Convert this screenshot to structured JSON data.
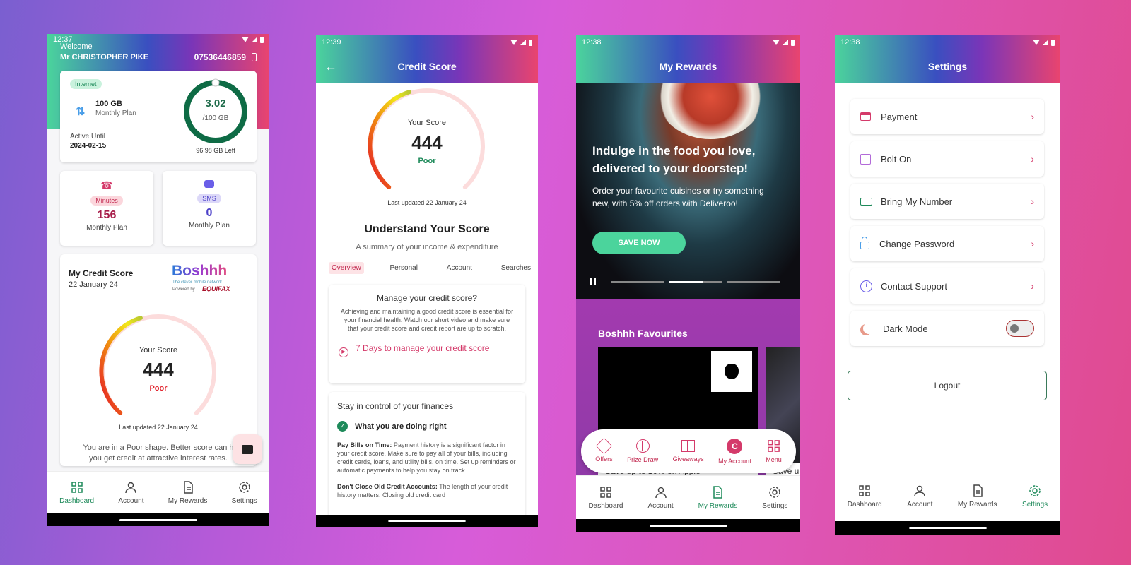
{
  "colors": {
    "brand_green": "#1e8a5a",
    "accent_pink": "#d43a6a",
    "poor_red": "#e0202a",
    "sms_blue": "#4b3fc8"
  },
  "phone1": {
    "time": "12:37",
    "welcome": "Welcome",
    "user_name": "Mr CHRISTOPHER PIKE",
    "phone_number": "07536446859",
    "internet_badge": "Internet",
    "data_amount": "100 GB",
    "data_plan": "Monthly Plan",
    "active_until_label": "Active Until",
    "active_until_date": "2024-02-15",
    "data_used": "3.02",
    "data_total": "/100 GB",
    "data_left": "96.98 GB Left",
    "data_used_fraction": 0.03,
    "minutes_badge": "Minutes",
    "minutes_value": "156",
    "minutes_plan": "Monthly Plan",
    "sms_badge": "SMS",
    "sms_value": "0",
    "sms_plan": "Monthly Plan",
    "credit_title": "My Credit Score",
    "credit_date": "22 January 24",
    "brand_logo": "Boshhh",
    "brand_tagline": "The clever mobile network",
    "powered_by": "Powered by",
    "equifax": "EQUIFAX",
    "score_label": "Your Score",
    "score": "444",
    "score_rating": "Poor",
    "last_updated": "Last updated 22 January 24",
    "shape_text": "You are in a Poor shape. Better score can h",
    "shape_text2": "you get credit at attractive interest rates.",
    "chat_icon": "chat-icon"
  },
  "phone2": {
    "time": "12:39",
    "title": "Credit Score",
    "score_label": "Your Score",
    "score": "444",
    "score_rating": "Poor",
    "last_updated": "Last updated 22 January 24",
    "understand_title": "Understand Your Score",
    "understand_sub": "A summary of your income & expenditure",
    "tabs": [
      "Overview",
      "Personal",
      "Account",
      "Searches"
    ],
    "manage_title": "Manage your credit score?",
    "manage_body": "Achieving and maintaining a good credit score is essential for your financial health. Watch our short video and make sure that your credit score and credit report are up to scratch.",
    "manage_link": "7 Days to manage your credit score",
    "control_title": "Stay in control of your finances",
    "doing_right": "What you are doing right",
    "tip1_bold": "Pay Bills on Time:",
    "tip1_text": " Payment history is a significant factor in your credit score. Make sure to pay all of your bills, including credit cards, loans, and utility bills, on time. Set up reminders or automatic payments to help you stay on track.",
    "tip2_bold": "Don't Close Old Credit Accounts:",
    "tip2_text": " The length of your credit history matters. Closing old credit card"
  },
  "phone3": {
    "time": "12:38",
    "title": "My Rewards",
    "hero_headline": "Indulge in the food you love, delivered to your doorstep!",
    "hero_body": "Order your favourite cuisines or try something new, with 5% off orders with Deliveroo!",
    "hero_button": "SAVE NOW",
    "favourites_title": "Boshhh Favourites",
    "offer1_caption": "Save up to 10% on Apple",
    "offer2_caption": "Save u",
    "menu_items": [
      {
        "label": "Offers",
        "icon": "offers-icon"
      },
      {
        "label": "Prize Draw",
        "icon": "prize-wheel-icon"
      },
      {
        "label": "Giveaways",
        "icon": "gift-icon"
      },
      {
        "label": "My Account",
        "icon": "account-c-icon",
        "letter": "C"
      },
      {
        "label": "Menu",
        "icon": "grid-icon"
      }
    ]
  },
  "phone4": {
    "time": "12:38",
    "title": "Settings",
    "items": [
      {
        "label": "Payment",
        "icon": "card-icon"
      },
      {
        "label": "Bolt On",
        "icon": "edit-icon"
      },
      {
        "label": "Bring My Number",
        "icon": "cash-icon"
      },
      {
        "label": "Change Password",
        "icon": "lock-icon"
      },
      {
        "label": "Contact Support",
        "icon": "info-icon"
      }
    ],
    "dark_mode": "Dark Mode",
    "dark_mode_on": false,
    "logout": "Logout"
  },
  "nav": {
    "dashboard": "Dashboard",
    "account": "Account",
    "rewards": "My Rewards",
    "settings": "Settings"
  }
}
